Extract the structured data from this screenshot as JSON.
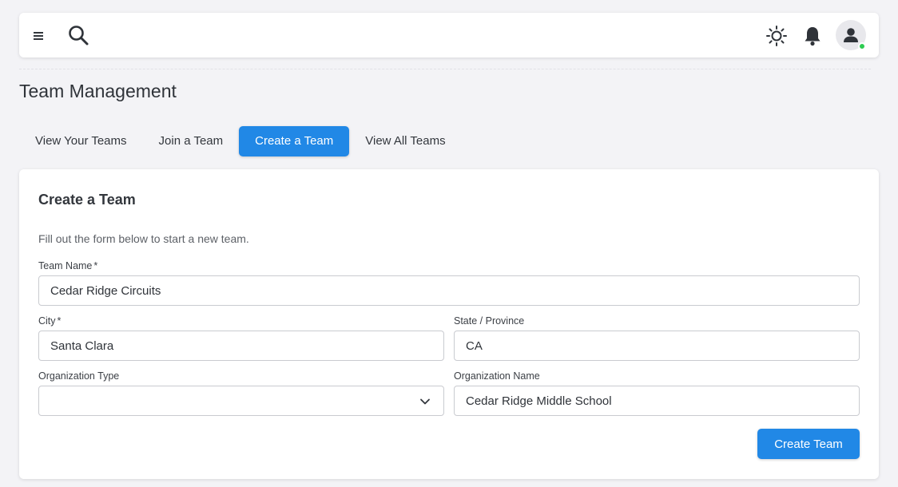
{
  "header": {
    "menu_icon": "hamburger-menu-icon",
    "search_icon": "search-icon",
    "theme_icon": "sun-icon",
    "notifications_icon": "bell-icon",
    "avatar_icon": "user-avatar-icon",
    "online_status_color": "#2ecc52"
  },
  "page": {
    "title": "Team Management"
  },
  "tabs": [
    {
      "label": "View Your Teams",
      "active": false
    },
    {
      "label": "Join a Team",
      "active": false
    },
    {
      "label": "Create a Team",
      "active": true
    },
    {
      "label": "View All Teams",
      "active": false
    }
  ],
  "form": {
    "title": "Create a Team",
    "description": "Fill out the form below to start a new team.",
    "required_marker": "*",
    "fields": {
      "team_name": {
        "label": "Team Name",
        "value": "Cedar Ridge Circuits",
        "required": true
      },
      "city": {
        "label": "City",
        "value": "Santa Clara",
        "required": true
      },
      "state": {
        "label": "State / Province",
        "value": "CA",
        "required": false
      },
      "org_type": {
        "label": "Organization Type",
        "value": "",
        "required": false
      },
      "org_name": {
        "label": "Organization Name",
        "value": "Cedar Ridge Middle School",
        "required": false
      }
    },
    "submit_label": "Create Team"
  },
  "colors": {
    "accent": "#2188e6",
    "background": "#f3f3f6",
    "card": "#ffffff"
  }
}
